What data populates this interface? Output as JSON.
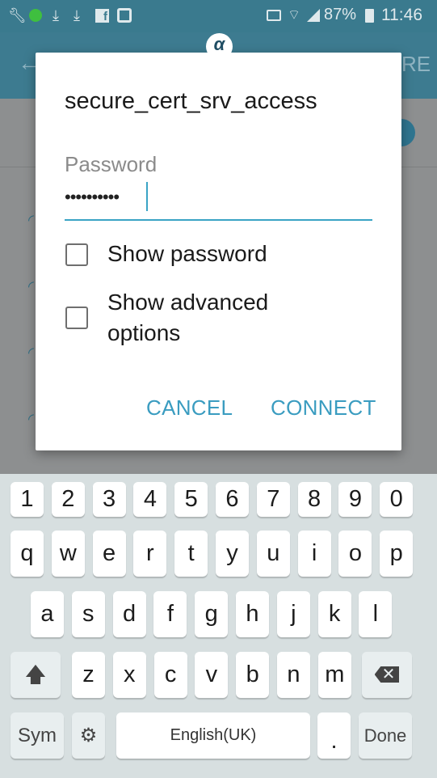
{
  "status_bar": {
    "left_icons": [
      "wrench-icon",
      "ring-app-icon",
      "download-icon",
      "download-icon",
      "facebook-icon",
      "instagram-icon"
    ],
    "right_icons": [
      "cast-icon",
      "wifi-icon",
      "signal-icon",
      "battery-icon"
    ],
    "battery": "87%",
    "time": "11:46"
  },
  "background": {
    "app_bar_action_partial": "RE",
    "accent": "#3a9cc0"
  },
  "dialog": {
    "title": "secure_cert_srv_access",
    "password_label": "Password",
    "password_value": "••••••••••",
    "show_password_label": "Show password",
    "show_password_checked": false,
    "show_advanced_label_line1": "Show advanced",
    "show_advanced_label_line2": "options",
    "show_advanced_checked": false,
    "cancel_label": "CANCEL",
    "connect_label": "CONNECT"
  },
  "keyboard": {
    "row1": [
      "1",
      "2",
      "3",
      "4",
      "5",
      "6",
      "7",
      "8",
      "9",
      "0"
    ],
    "row2": [
      "q",
      "w",
      "e",
      "r",
      "t",
      "y",
      "u",
      "i",
      "o",
      "p"
    ],
    "row3": [
      "a",
      "s",
      "d",
      "f",
      "g",
      "h",
      "j",
      "k",
      "l"
    ],
    "row4": [
      "z",
      "x",
      "c",
      "v",
      "b",
      "n",
      "m"
    ],
    "sym_label": "Sym",
    "space_label": "English(UK)",
    "period_label": ".",
    "done_label": "Done"
  }
}
